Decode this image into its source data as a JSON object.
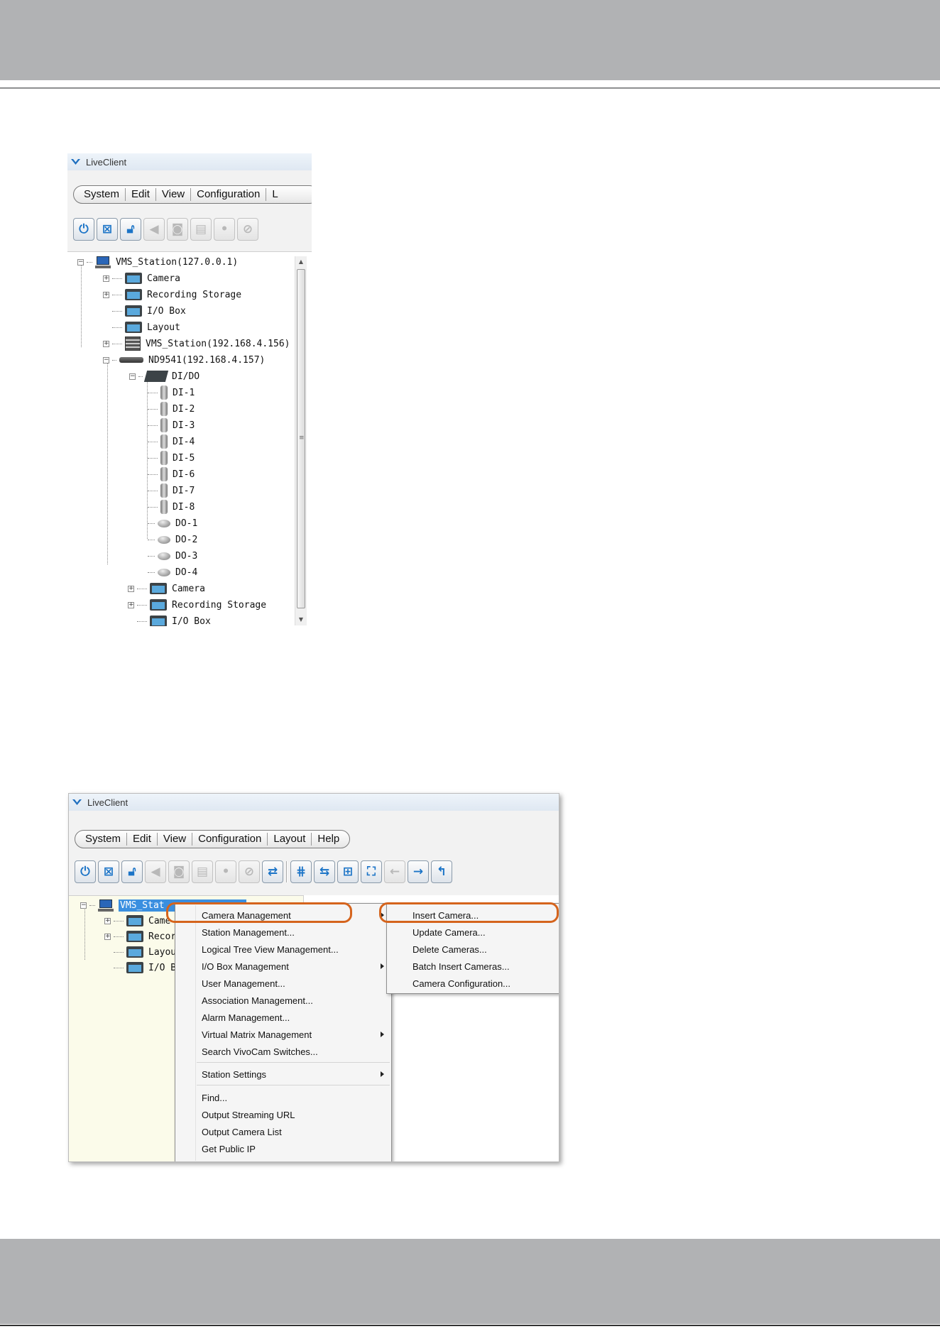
{
  "screenshot_top": {
    "title": "LiveClient",
    "menu": [
      "System",
      "Edit",
      "View",
      "Configuration",
      "L"
    ],
    "toolbar_icons": [
      "power-icon",
      "close-window-icon",
      "lock-icon",
      "speaker-icon",
      "camera-icon",
      "print-icon",
      "record-icon",
      "no-sign-icon"
    ],
    "tree": {
      "root": "VMS_Station(127.0.0.1)",
      "nodes": {
        "camera": "Camera",
        "recording_storage": "Recording Storage",
        "io_box": "I/O Box",
        "layout": "Layout",
        "station2": "VMS_Station(192.168.4.156)",
        "nd": "ND9541(192.168.4.157)",
        "dido": "DI/DO",
        "di": [
          "DI-1",
          "DI-2",
          "DI-3",
          "DI-4",
          "DI-5",
          "DI-6",
          "DI-7",
          "DI-8"
        ],
        "do": [
          "DO-1",
          "DO-2",
          "DO-3",
          "DO-4"
        ],
        "nd_camera": "Camera",
        "nd_recording_storage": "Recording Storage",
        "nd_io_box": "I/O Box"
      }
    }
  },
  "screenshot_bottom": {
    "title": "LiveClient",
    "menu": [
      "System",
      "Edit",
      "View",
      "Configuration",
      "Layout",
      "Help"
    ],
    "tree": {
      "root_selected": "VMS_Stat",
      "camera": "Came",
      "recording": "Recor",
      "layout": "Layou",
      "io_box": "I/O B"
    },
    "context_menu": [
      "Camera Management",
      "Station Management...",
      "Logical Tree View Management...",
      "I/O Box Management",
      "User Management...",
      "Association Management...",
      "Alarm Management...",
      "Virtual Matrix Management",
      "Search VivoCam Switches...",
      "Station Settings",
      "Find...",
      "Output Streaming URL",
      "Output Camera List",
      "Get Public IP"
    ],
    "sub_menu": [
      "Insert Camera...",
      "Update Camera...",
      "Delete Cameras...",
      "Batch Insert Cameras...",
      "Camera Configuration..."
    ]
  },
  "colors": {
    "band_gray": "#b1b2b4",
    "highlight_orange": "#d5641d",
    "selection_blue": "#3a8fe0",
    "accent_blue": "#1b74c7"
  }
}
